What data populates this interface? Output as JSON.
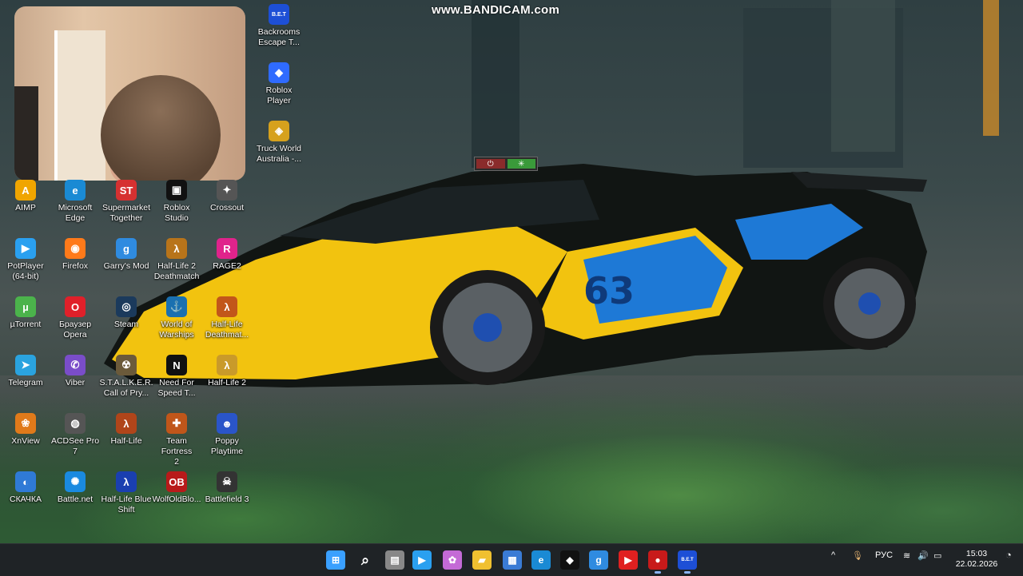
{
  "watermark": "www.BANDICAM.com",
  "desktop_icons": [
    {
      "label": "Backrooms\nEscape T...",
      "glyph": "B.E.T",
      "color": "#1d4fd6"
    },
    {
      "label": "Roblox Player",
      "glyph": "◆",
      "color": "#2f6bff"
    },
    {
      "label": "Truck World\nAustralia -...",
      "glyph": "◈",
      "color": "#d6a11d"
    },
    {
      "label": "AIMP",
      "glyph": "A",
      "color": "#f0a500"
    },
    {
      "label": "Microsoft\nEdge",
      "glyph": "e",
      "color": "#1a8ad4"
    },
    {
      "label": "Supermarket\nTogether",
      "glyph": "ST",
      "color": "#d63131"
    },
    {
      "label": "Roblox\nStudio",
      "glyph": "▣",
      "color": "#111111"
    },
    {
      "label": "Crossout",
      "glyph": "✦",
      "color": "#555555"
    },
    {
      "label": "PotPlayer\n(64-bit)",
      "glyph": "▶",
      "color": "#2aa0f0"
    },
    {
      "label": "Firefox",
      "glyph": "◉",
      "color": "#ff7a1a"
    },
    {
      "label": "Garry's Mod",
      "glyph": "g",
      "color": "#2f8be0"
    },
    {
      "label": "Half-Life 2\nDeathmatch",
      "glyph": "λ",
      "color": "#b8741a"
    },
    {
      "label": "RAGE2",
      "glyph": "R",
      "color": "#e0238b"
    },
    {
      "label": "µTorrent",
      "glyph": "µ",
      "color": "#4bb34b"
    },
    {
      "label": "Браузер\nOpera",
      "glyph": "O",
      "color": "#e0202a"
    },
    {
      "label": "Steam",
      "glyph": "◎",
      "color": "#1b3a5c"
    },
    {
      "label": "World of\nWarships",
      "glyph": "⚓",
      "color": "#1a70b0"
    },
    {
      "label": "Half-Life\nDeathmat...",
      "glyph": "λ",
      "color": "#c2561a"
    },
    {
      "label": "Telegram",
      "glyph": "➤",
      "color": "#2aa3df"
    },
    {
      "label": "Viber",
      "glyph": "✆",
      "color": "#7a4dc9"
    },
    {
      "label": "S.T.A.L.K.E.R.\nCall of Pry...",
      "glyph": "☢",
      "color": "#6b5a3a"
    },
    {
      "label": "Need For\nSpeed T...",
      "glyph": "N",
      "color": "#111111"
    },
    {
      "label": "Half-Life 2",
      "glyph": "λ",
      "color": "#c99a2a"
    },
    {
      "label": "XnView",
      "glyph": "❀",
      "color": "#e07a1a"
    },
    {
      "label": "ACDSee Pro\n7",
      "glyph": "◍",
      "color": "#555555"
    },
    {
      "label": "Half-Life",
      "glyph": "λ",
      "color": "#b0451a"
    },
    {
      "label": "Team Fortress\n2",
      "glyph": "✚",
      "color": "#c0561a"
    },
    {
      "label": "Poppy\nPlaytime",
      "glyph": "☻",
      "color": "#2a55c9"
    },
    {
      "label": "СКАЧКА",
      "glyph": "◐",
      "color": "#2f7ad6"
    },
    {
      "label": "Battle.net",
      "glyph": "✺",
      "color": "#1a8ae0"
    },
    {
      "label": "Half-Life Blue\nShift",
      "glyph": "λ",
      "color": "#1a3fb0"
    },
    {
      "label": "WolfOldBlo...",
      "glyph": "OB",
      "color": "#b81a1a"
    },
    {
      "label": "Battlefield 3",
      "glyph": "☠",
      "color": "#333333"
    }
  ],
  "taskbar": {
    "apps": [
      {
        "name": "start-button",
        "glyph": "⊞",
        "color": "#3aa0ff"
      },
      {
        "name": "search-icon",
        "glyph": "⌕",
        "color": "transparent"
      },
      {
        "name": "task-view-icon",
        "glyph": "▤",
        "color": "#888888"
      },
      {
        "name": "potplayer-icon",
        "glyph": "▶",
        "color": "#2aa0f0"
      },
      {
        "name": "copilot-icon",
        "glyph": "✿",
        "color": "#c46ad6"
      },
      {
        "name": "file-explorer-icon",
        "glyph": "▰",
        "color": "#f0c030"
      },
      {
        "name": "store-icon",
        "glyph": "▦",
        "color": "#3a7bd5"
      },
      {
        "name": "edge-icon",
        "glyph": "e",
        "color": "#1a8ad4"
      },
      {
        "name": "roblox-icon",
        "glyph": "◆",
        "color": "#111111"
      },
      {
        "name": "garrys-mod-icon",
        "glyph": "g",
        "color": "#2f8be0"
      },
      {
        "name": "youtube-icon",
        "glyph": "▶",
        "color": "#e02020"
      },
      {
        "name": "record-icon",
        "glyph": "●",
        "color": "#c81a1a"
      },
      {
        "name": "bet-icon",
        "glyph": "B.E.T",
        "color": "#1d4fd6"
      }
    ],
    "tray": {
      "chevron": "^",
      "mic": "🎙",
      "language": "РУС",
      "wifi": "≋",
      "volume": "🔊",
      "battery": "▭",
      "time": "15:03",
      "date": "22.02.2026"
    }
  }
}
